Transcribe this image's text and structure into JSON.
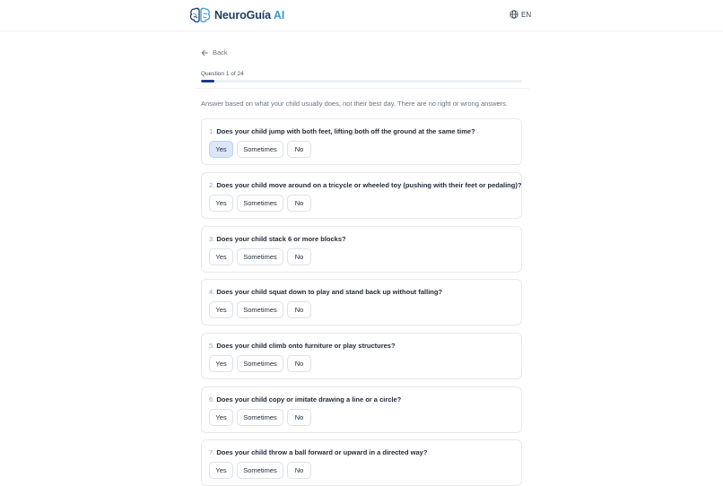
{
  "header": {
    "brand_main": "NeuroGuía",
    "brand_ai": "AI",
    "language": "EN"
  },
  "nav": {
    "back_label": "Back"
  },
  "progress": {
    "label": "Question 1 of 24",
    "fraction": 0.0417
  },
  "hint": "Answer based on what your child usually does, not their best day. There are no right or wrong answers.",
  "colors": {
    "brand_dark": "#1e3a5f",
    "brand_accent": "#3b9bd6",
    "selected_bg": "#dbe7f8",
    "progress_fill": "#1e3a8a"
  },
  "options": {
    "yes": "Yes",
    "sometimes": "Sometimes",
    "no": "No"
  },
  "questions": [
    {
      "num": "1.",
      "text": "Does your child jump with both feet, lifting both off the ground at the same time?",
      "selected": "yes"
    },
    {
      "num": "2.",
      "text": "Does your child move around on a tricycle or wheeled toy (pushing with their feet or pedaling)?",
      "selected": ""
    },
    {
      "num": "3.",
      "text": "Does your child stack 6 or more blocks?",
      "selected": ""
    },
    {
      "num": "4.",
      "text": "Does your child squat down to play and stand back up without falling?",
      "selected": ""
    },
    {
      "num": "5.",
      "text": "Does your child climb onto furniture or play structures?",
      "selected": ""
    },
    {
      "num": "6.",
      "text": "Does your child copy or imitate drawing a line or a circle?",
      "selected": ""
    },
    {
      "num": "7.",
      "text": "Does your child throw a ball forward or upward in a directed way?",
      "selected": ""
    }
  ]
}
